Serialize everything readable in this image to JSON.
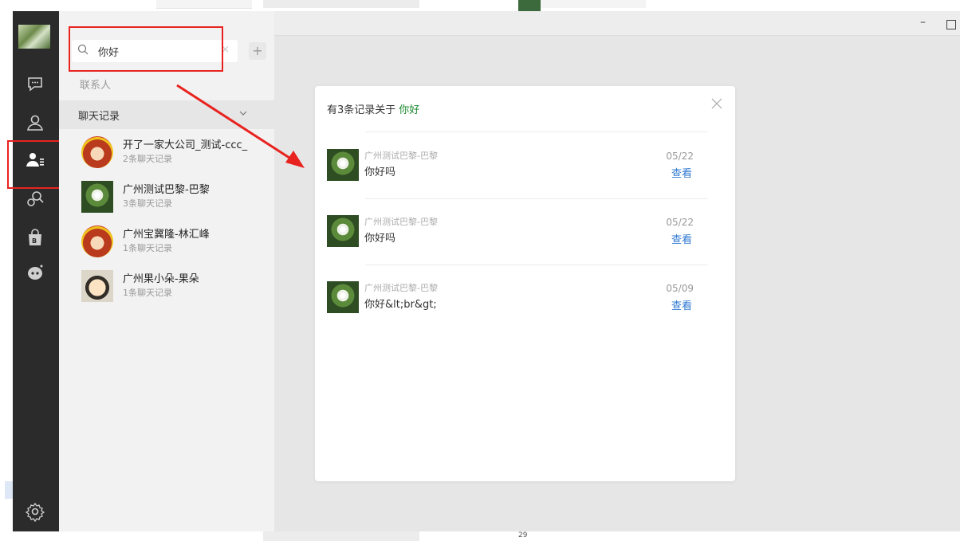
{
  "background_window": {
    "bottom_text": "29"
  },
  "search": {
    "query": "你好",
    "clear": "×",
    "add": "+"
  },
  "sections": {
    "contacts": "联系人",
    "chat_records": "聊天记录"
  },
  "contacts": [
    {
      "name": "开了一家大公司_测试-ccc_",
      "sub": "2条聊天记录",
      "avatar": "bull-avatar"
    },
    {
      "name": "广州测试巴黎-巴黎",
      "sub": "3条聊天记录",
      "avatar": "flower-avatar"
    },
    {
      "name": "广州宝冀隆-林汇峰",
      "sub": "1条聊天记录",
      "avatar": "bull-avatar"
    },
    {
      "name": "广州果小朵-果朵",
      "sub": "1条聊天记录",
      "avatar": "cartoon-avatar"
    }
  ],
  "window_controls": {
    "minimize": "–"
  },
  "dialog": {
    "title_prefix": "有3条记录关于",
    "keyword": "你好",
    "records": [
      {
        "from": "广州测试巴黎-巴黎",
        "message": "你好吗",
        "date": "05/22",
        "action": "查看"
      },
      {
        "from": "广州测试巴黎-巴黎",
        "message": "你好吗",
        "date": "05/22",
        "action": "查看"
      },
      {
        "from": "广州测试巴黎-巴黎",
        "message": "你好&lt;br&gt;",
        "date": "05/09",
        "action": "查看"
      }
    ]
  },
  "colors": {
    "highlight_red": "#e8231f",
    "keyword_green": "#1a8a2e",
    "link_blue": "#2f79d1",
    "sidebar_dark": "#2b2b2b"
  }
}
